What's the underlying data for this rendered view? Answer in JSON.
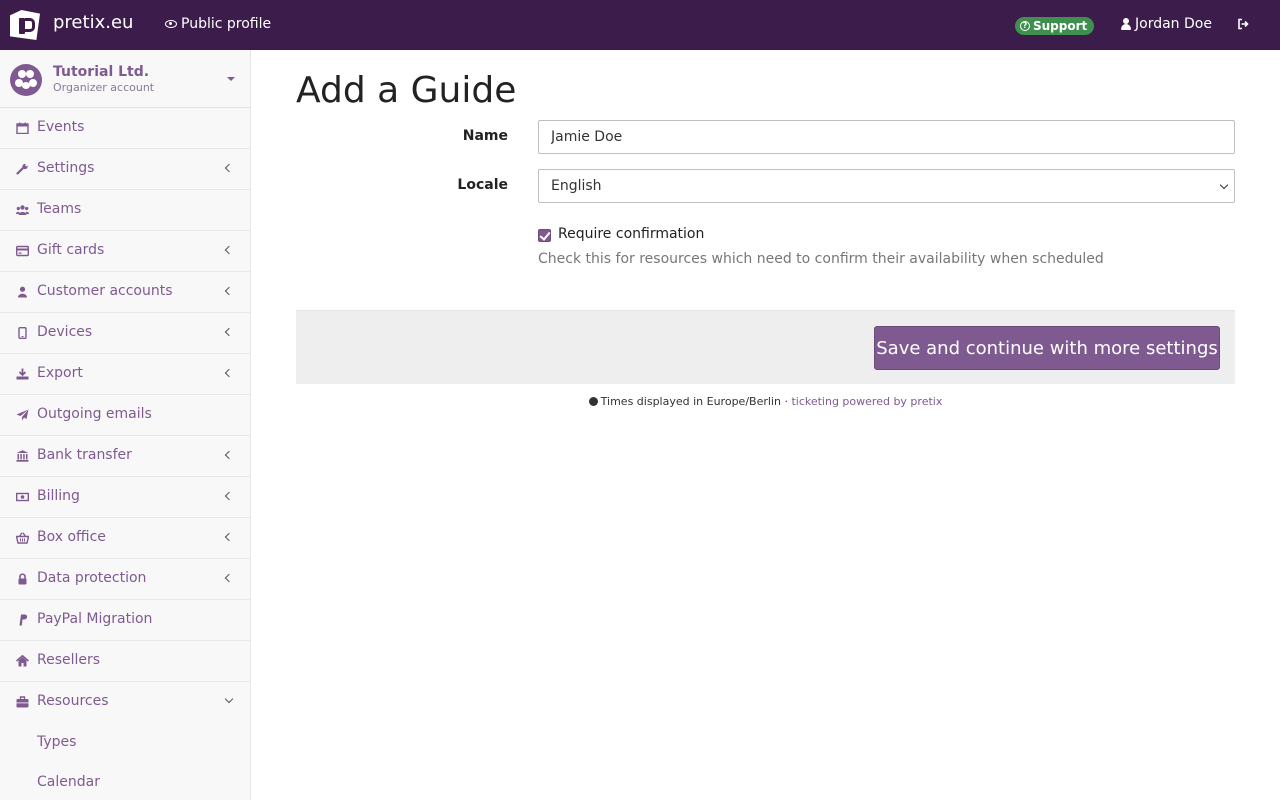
{
  "topbar": {
    "brand": "pretix.eu",
    "public_profile": "Public profile",
    "support": "Support",
    "user": "Jordan Doe"
  },
  "organizer": {
    "name": "Tutorial Ltd.",
    "subtitle": "Organizer account"
  },
  "sidebar": {
    "items": [
      {
        "label": "Events",
        "icon": "calendar-icon",
        "expandable": false
      },
      {
        "label": "Settings",
        "icon": "wrench-icon",
        "expandable": true
      },
      {
        "label": "Teams",
        "icon": "group-icon",
        "expandable": false
      },
      {
        "label": "Gift cards",
        "icon": "credit-card-icon",
        "expandable": true
      },
      {
        "label": "Customer accounts",
        "icon": "user-icon",
        "expandable": true
      },
      {
        "label": "Devices",
        "icon": "tablet-icon",
        "expandable": true
      },
      {
        "label": "Export",
        "icon": "download-icon",
        "expandable": true
      },
      {
        "label": "Outgoing emails",
        "icon": "paper-plane-icon",
        "expandable": false
      },
      {
        "label": "Bank transfer",
        "icon": "bank-icon",
        "expandable": true
      },
      {
        "label": "Billing",
        "icon": "money-icon",
        "expandable": true
      },
      {
        "label": "Box office",
        "icon": "basket-icon",
        "expandable": true
      },
      {
        "label": "Data protection",
        "icon": "lock-icon",
        "expandable": true
      },
      {
        "label": "PayPal Migration",
        "icon": "paypal-icon",
        "expandable": false
      },
      {
        "label": "Resellers",
        "icon": "home-icon",
        "expandable": false
      },
      {
        "label": "Resources",
        "icon": "briefcase-icon",
        "expandable": true,
        "expanded": true
      }
    ],
    "sub_items": [
      "Types",
      "Calendar"
    ]
  },
  "page": {
    "title": "Add a Guide"
  },
  "form": {
    "name_label": "Name",
    "name_value": "Jamie Doe",
    "locale_label": "Locale",
    "locale_value": "English",
    "confirm_label": "Require confirmation",
    "confirm_checked": true,
    "confirm_help": "Check this for resources which need to confirm their availability when scheduled",
    "save_label": "Save and continue with more settings"
  },
  "footer": {
    "timezone": "Times displayed in Europe/Berlin",
    "separator": "·",
    "powered_by": "ticketing powered by pretix"
  },
  "colors": {
    "navbar": "#3b1c4a",
    "accent": "#7f5a91",
    "support_badge": "#3f8f4f"
  }
}
